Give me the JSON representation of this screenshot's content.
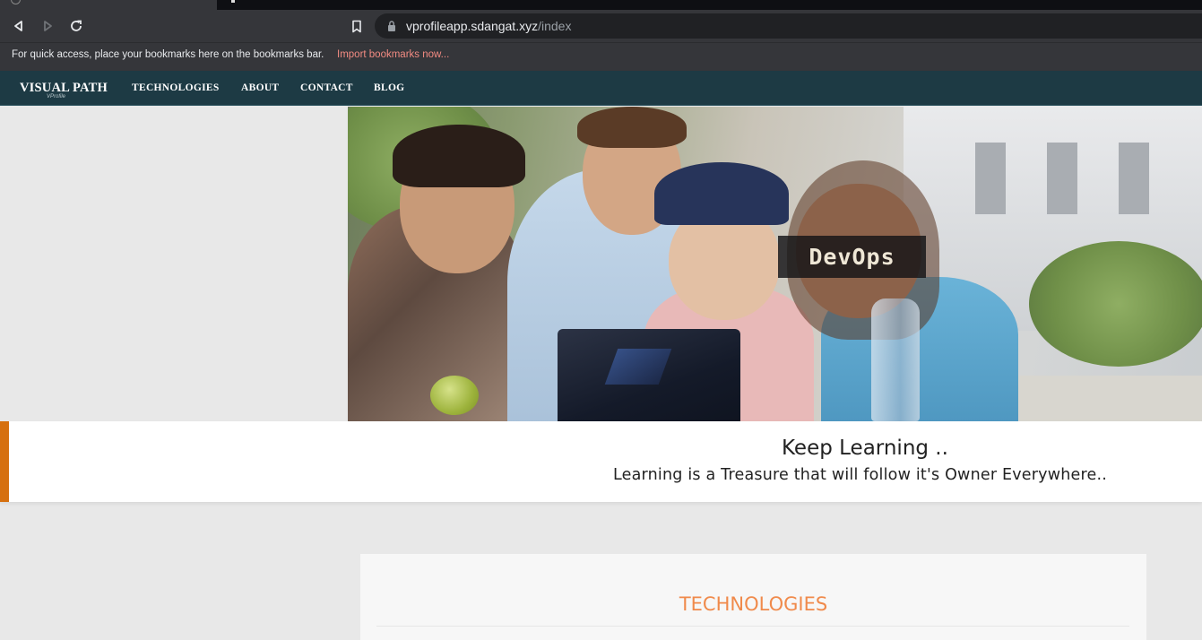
{
  "browser": {
    "url_host": "vprofileapp.sdangat.xyz",
    "url_path": "/index",
    "bookmarks_bar": {
      "message": "For quick access, place your bookmarks here on the bookmarks bar.",
      "import_link": "Import bookmarks now..."
    },
    "icons": {
      "back": "back-arrow-icon",
      "forward": "forward-arrow-icon",
      "reload": "reload-icon",
      "bookmark": "bookmark-icon",
      "lock": "lock-icon"
    }
  },
  "site_nav": {
    "brand": "VISUAL PATH",
    "brand_sub": "VProfile",
    "links": [
      "TECHNOLOGIES",
      "ABOUT",
      "CONTACT",
      "BLOG"
    ]
  },
  "hero": {
    "caption": "DevOps"
  },
  "quote": {
    "title": "Keep Learning ..",
    "subtitle": "Learning is a Treasure that will follow it's Owner Everywhere.."
  },
  "technologies": {
    "heading": "TECHNOLOGIES"
  },
  "colors": {
    "nav_bg": "#1d3a44",
    "accent_orange": "#d6700f",
    "heading_orange": "#f08a4b"
  }
}
